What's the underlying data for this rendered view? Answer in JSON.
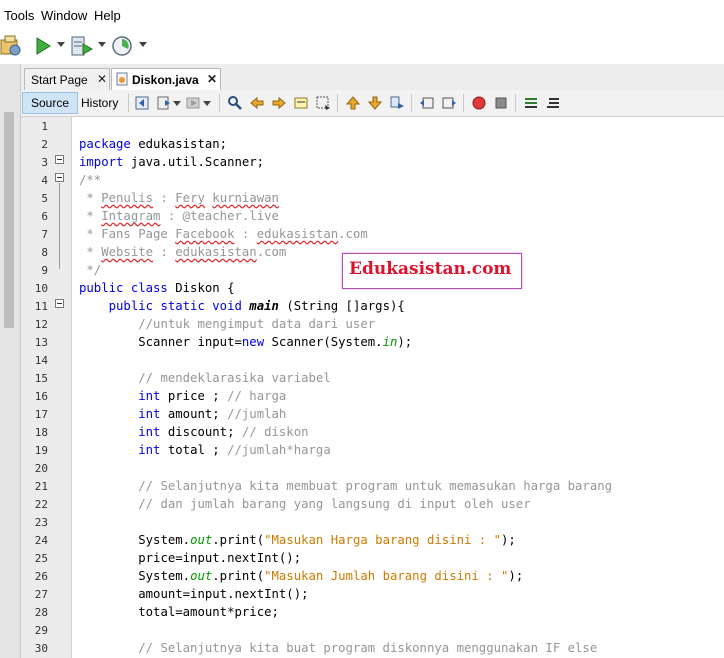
{
  "menu": {
    "items": [
      "Tools",
      "Window",
      "Help"
    ]
  },
  "tabs": [
    {
      "label": "Start Page",
      "active": false
    },
    {
      "label": "Diskon.java",
      "active": true
    }
  ],
  "editor_toolbar": {
    "source_label": "Source",
    "history_label": "History"
  },
  "line_numbers": [
    "1",
    "2",
    "3",
    "4",
    "5",
    "6",
    "7",
    "8",
    "9",
    "10",
    "11",
    "12",
    "13",
    "14",
    "15",
    "16",
    "17",
    "18",
    "19",
    "20",
    "21",
    "22",
    "23",
    "24",
    "25",
    "26",
    "27",
    "28",
    "29",
    "30"
  ],
  "code": {
    "l1": "",
    "l2_kw": "package",
    "l2_rest": " edukasistan;",
    "l3_kw": "import",
    "l3_rest": " java.util.Scanner;",
    "l4": "/**",
    "l5_a": " * ",
    "l5_b": "Penulis",
    "l5_c": " : ",
    "l5_d": "Fery",
    "l5_e": " ",
    "l5_f": "kurniawan",
    "l6_a": " * ",
    "l6_b": "Intagram",
    "l6_c": " : @teacher.live",
    "l7_a": " * Fans Page ",
    "l7_b": "Facebook",
    "l7_c": " : ",
    "l7_d": "edukasistan",
    "l7_e": ".com",
    "l8_a": " * ",
    "l8_b": "Website",
    "l8_c": " : ",
    "l8_d": "edukasistan",
    "l8_e": ".com",
    "l9": " */",
    "l10_kw": "public class",
    "l10_rest": " Diskon {",
    "l11_ind": "    ",
    "l11_kw": "public static void",
    "l11_sp": " ",
    "l11_m": "main",
    "l11_rest": " (String []args){",
    "l12_ind": "        ",
    "l12_cm": "//untuk mengimput data dari user",
    "l13_ind": "        ",
    "l13_a": "Scanner input=",
    "l13_kw": "new",
    "l13_b": " Scanner(System.",
    "l13_f": "in",
    "l13_c": ");",
    "l14": "",
    "l15_ind": "        ",
    "l15_cm": "// mendeklarasika variabel",
    "l16_ind": "        ",
    "l16_kw": "int",
    "l16_a": " price ; ",
    "l16_cm": "// harga",
    "l17_ind": "        ",
    "l17_kw": "int",
    "l17_a": " amount; ",
    "l17_cm": "//jumlah",
    "l18_ind": "        ",
    "l18_kw": "int",
    "l18_a": " discount; ",
    "l18_cm": "// diskon",
    "l19_ind": "        ",
    "l19_kw": "int",
    "l19_a": " total ; ",
    "l19_cm": "//jumlah*harga",
    "l20": "",
    "l21_ind": "        ",
    "l21_cm": "// Selanjutnya kita membuat program untuk memasukan harga barang",
    "l22_ind": "        ",
    "l22_cm": "// dan jumlah barang yang langsung di input oleh user",
    "l23": "",
    "l24_ind": "        ",
    "l24_a": "System.",
    "l24_f": "out",
    "l24_b": ".print(",
    "l24_s": "\"Masukan Harga barang disini : \"",
    "l24_c": ");",
    "l25_ind": "        ",
    "l25_a": "price=input.nextInt();",
    "l26_ind": "        ",
    "l26_a": "System.",
    "l26_f": "out",
    "l26_b": ".print(",
    "l26_s": "\"Masukan Jumlah barang disini : \"",
    "l26_c": ");",
    "l27_ind": "        ",
    "l27_a": "amount=input.nextInt();",
    "l28_ind": "        ",
    "l28_a": "total=amount*price;",
    "l29": "",
    "l30_ind": "        ",
    "l30_cm": "// Selanjutnya kita buat program diskonnya menggunakan IF else"
  },
  "watermark": "Edukasistan.com",
  "colors": {
    "keyword": "#0000e6",
    "comment": "#969696",
    "string": "#ce7b00",
    "field": "#009900",
    "watermark": "#e0112b"
  },
  "icons": [
    "project-properties-icon",
    "run-icon",
    "debug-icon",
    "profile-icon",
    "back-icon",
    "forward-icon",
    "find-icon",
    "bookmark-icon",
    "toggle-breakpoint-icon",
    "stop-macro-icon",
    "comment-icon",
    "uncomment-icon"
  ]
}
